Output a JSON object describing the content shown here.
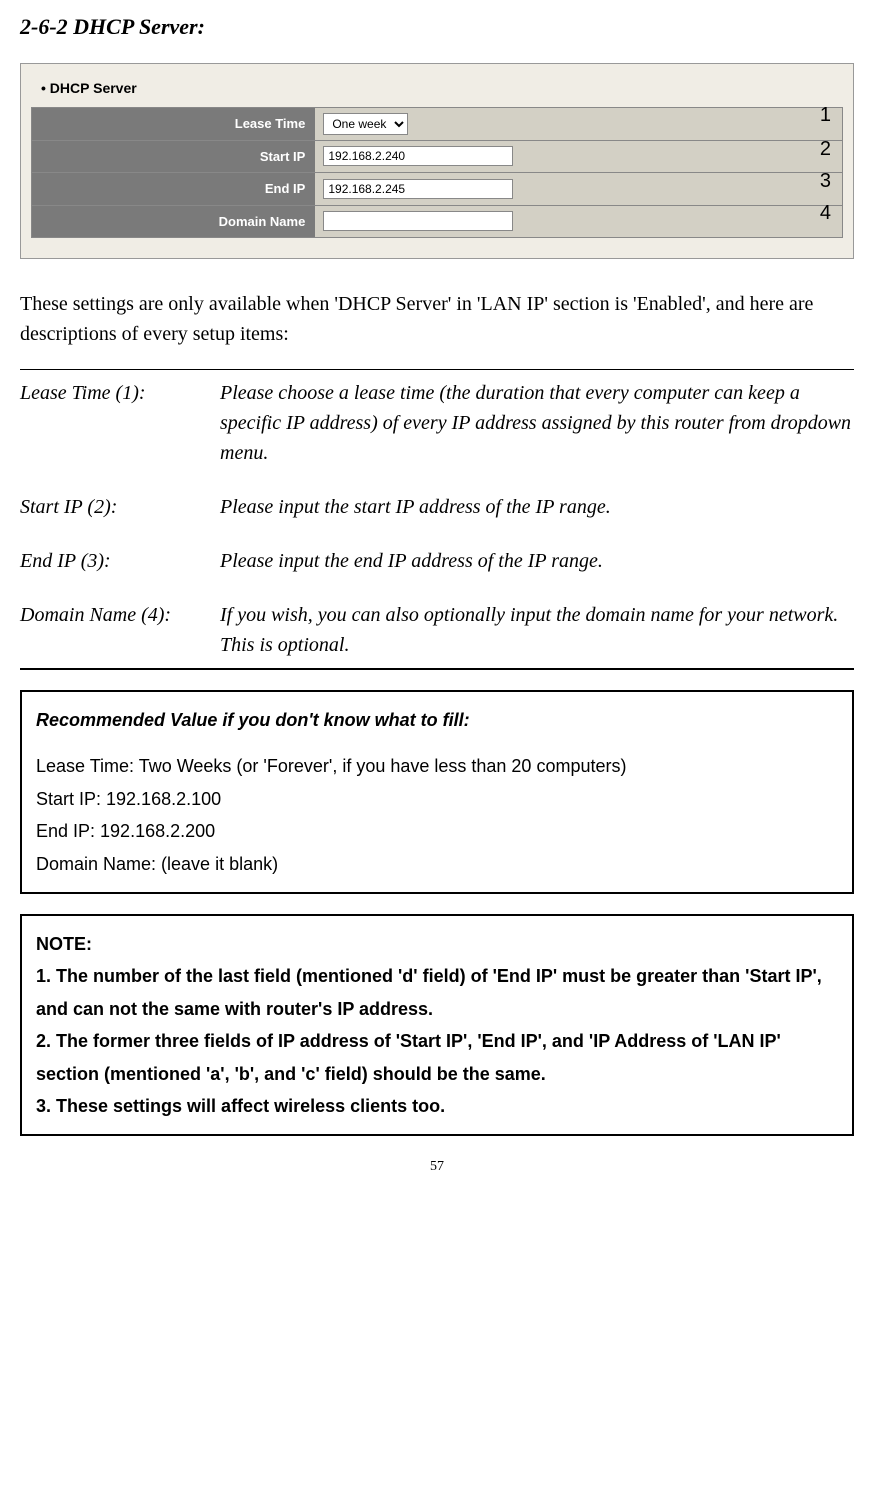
{
  "section_title": "2-6-2 DHCP Server:",
  "screenshot": {
    "panel_title": "DHCP Server",
    "rows": {
      "lease_time": {
        "label": "Lease Time",
        "value": "One week"
      },
      "start_ip": {
        "label": "Start IP",
        "value": "192.168.2.240"
      },
      "end_ip": {
        "label": "End IP",
        "value": "192.168.2.245"
      },
      "domain": {
        "label": "Domain Name",
        "value": ""
      }
    },
    "callouts": [
      "1",
      "2",
      "3",
      "4"
    ]
  },
  "intro_text": "These settings are only available when 'DHCP Server' in 'LAN IP' section is 'Enabled', and here are descriptions of every setup items:",
  "definitions": [
    {
      "term": "Lease Time (1):",
      "desc": "Please choose a lease time (the duration that every computer can keep a specific IP address) of every IP address assigned by this router from dropdown menu."
    },
    {
      "term": "Start IP (2):",
      "desc": "Please input the start IP address of the IP range."
    },
    {
      "term": "End IP (3):",
      "desc": "Please input the end IP address of the IP range."
    },
    {
      "term": "Domain Name (4):",
      "desc": "If you wish, you can also optionally input the domain name for your network. This is optional."
    }
  ],
  "rec_box": {
    "title": "Recommended Value if you don't know what to fill:",
    "lines": [
      "Lease Time: Two Weeks (or 'Forever', if you have less than 20 computers)",
      "Start IP: 192.168.2.100",
      "End IP: 192.168.2.200",
      "Domain Name: (leave it blank)"
    ]
  },
  "note_box": {
    "title": "NOTE:",
    "lines": [
      "1. The number of the last field (mentioned 'd' field) of 'End IP' must be greater than 'Start IP', and can not the same with router's IP address.",
      "2. The former three fields of IP address of 'Start IP', 'End IP', and 'IP Address of 'LAN IP' section (mentioned 'a', 'b', and 'c' field) should be the same.",
      "3. These settings will affect wireless clients too."
    ]
  },
  "page_number": "57"
}
